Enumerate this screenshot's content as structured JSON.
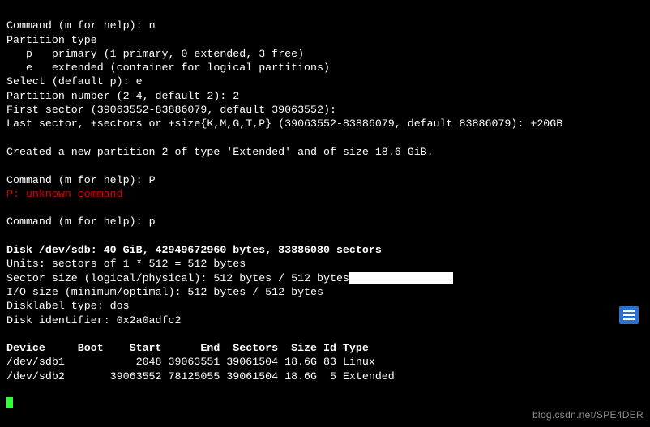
{
  "cmd1_prompt": "Command (m for help): ",
  "cmd1_input": "n",
  "ptype_header": "Partition type",
  "ptype_p": "   p   primary (1 primary, 0 extended, 3 free)",
  "ptype_e": "   e   extended (container for logical partitions)",
  "select_prompt": "Select (default p): ",
  "select_input": "e",
  "pnum_prompt": "Partition number (2-4, default 2): ",
  "pnum_input": "2",
  "first_sector": "First sector (39063552-83886079, default 39063552):",
  "last_sector_prompt": "Last sector, +sectors or +size{K,M,G,T,P} (39063552-83886079, default 83886079): ",
  "last_sector_input": "+20GB",
  "created_msg": "Created a new partition 2 of type 'Extended' and of size 18.6 GiB.",
  "cmd2_prompt": "Command (m for help): ",
  "cmd2_input": "P",
  "unknown_cmd": "P: unknown command",
  "cmd3_prompt": "Command (m for help): ",
  "cmd3_input": "p",
  "disk_hdr": "Disk /dev/sdb: 40 GiB, 42949672960 bytes, 83886080 sectors",
  "units": "Units: sectors of 1 * 512 = 512 bytes",
  "sector_size_a": "Sector size (logical/physical): 512 bytes / 512 bytes",
  "io_size": "I/O size (minimum/optimal): 512 bytes / 512 bytes",
  "dlabel": "Disklabel type: dos",
  "diskid": "Disk identifier: 0x2a0adfc2",
  "tbl_head": "Device     Boot    Start      End  Sectors  Size Id Type",
  "tbl_row1": "/dev/sdb1           2048 39063551 39061504 18.6G 83 Linux",
  "tbl_row2": "/dev/sdb2       39063552 78125055 39061504 18.6G  5 Extended",
  "hl_spaces": "                ",
  "watermark": "blog.csdn.net/SPE4DER",
  "chart_data": {
    "type": "table",
    "title": "Disk /dev/sdb: 40 GiB, 42949672960 bytes, 83886080 sectors",
    "columns": [
      "Device",
      "Boot",
      "Start",
      "End",
      "Sectors",
      "Size",
      "Id",
      "Type"
    ],
    "rows": [
      {
        "Device": "/dev/sdb1",
        "Boot": "",
        "Start": 2048,
        "End": 39063551,
        "Sectors": 39061504,
        "Size": "18.6G",
        "Id": 83,
        "Type": "Linux"
      },
      {
        "Device": "/dev/sdb2",
        "Boot": "",
        "Start": 39063552,
        "End": 78125055,
        "Sectors": 39061504,
        "Size": "18.6G",
        "Id": 5,
        "Type": "Extended"
      }
    ]
  }
}
